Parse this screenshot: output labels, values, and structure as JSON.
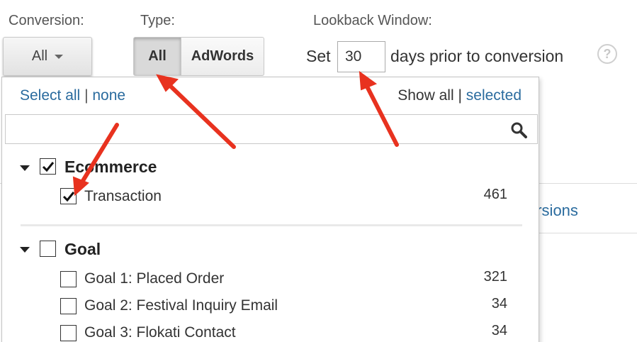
{
  "conversion": {
    "label": "Conversion:",
    "value": "All"
  },
  "type": {
    "label": "Type:",
    "options": [
      "All",
      "AdWords"
    ],
    "selected": "All"
  },
  "lookback": {
    "label": "Lookback Window:",
    "prefix": "Set",
    "value": "30",
    "suffix": "days prior to conversion",
    "help_icon": "?"
  },
  "background": {
    "partial_text": "ersions"
  },
  "dropdown": {
    "select_all": "Select all",
    "separator": "|",
    "select_none": "none",
    "show_all": "Show all",
    "show_selected": "selected",
    "search": {
      "value": "",
      "icon": "search-icon"
    },
    "groups": [
      {
        "name": "Ecommerce",
        "checked": true,
        "items": [
          {
            "name": "Transaction",
            "count": "461",
            "checked": true
          }
        ]
      },
      {
        "name": "Goal",
        "checked": false,
        "items": [
          {
            "name": "Goal 1: Placed Order",
            "count": "321",
            "checked": false
          },
          {
            "name": "Goal 2: Festival Inquiry Email",
            "count": "34",
            "checked": false
          },
          {
            "name": "Goal 3: Flokati Contact",
            "count": "34",
            "checked": false
          }
        ]
      }
    ]
  },
  "colors": {
    "link": "#2a6b9e",
    "annotation_arrow": "#e8321f"
  }
}
